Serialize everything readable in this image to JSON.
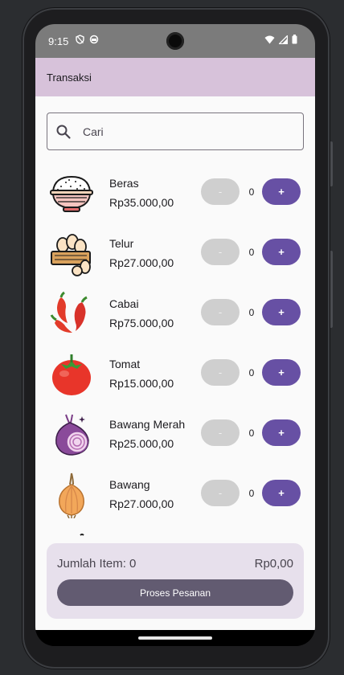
{
  "status_bar": {
    "time": "9:15",
    "left_icons": [
      "shield-icon",
      "sync-icon"
    ],
    "right_icons": [
      "wifi-icon",
      "signal-icon",
      "battery-icon"
    ]
  },
  "app_bar": {
    "title": "Transaksi"
  },
  "search": {
    "placeholder": "Cari",
    "value": ""
  },
  "products": [
    {
      "name": "Beras",
      "price": "Rp35.000,00",
      "qty": "0",
      "icon": "rice-bowl-icon"
    },
    {
      "name": "Telur",
      "price": "Rp27.000,00",
      "qty": "0",
      "icon": "eggs-basket-icon"
    },
    {
      "name": "Cabai",
      "price": "Rp75.000,00",
      "qty": "0",
      "icon": "chili-icon"
    },
    {
      "name": "Tomat",
      "price": "Rp15.000,00",
      "qty": "0",
      "icon": "tomato-icon"
    },
    {
      "name": "Bawang Merah",
      "price": "Rp25.000,00",
      "qty": "0",
      "icon": "red-onion-icon"
    },
    {
      "name": "Bawang",
      "price": "Rp27.000,00",
      "qty": "0",
      "icon": "onion-icon"
    }
  ],
  "buttons": {
    "minus": "-",
    "plus": "+"
  },
  "summary": {
    "item_count": "Jumlah Item: 0",
    "total": "Rp0,00",
    "process_label": "Proses Pesanan"
  },
  "colors": {
    "app_bar": "#d7c2da",
    "primary": "#6750a4",
    "secondary": "#625b71",
    "summary_bg": "#e7e0ec",
    "disabled": "#cfcfcf"
  }
}
